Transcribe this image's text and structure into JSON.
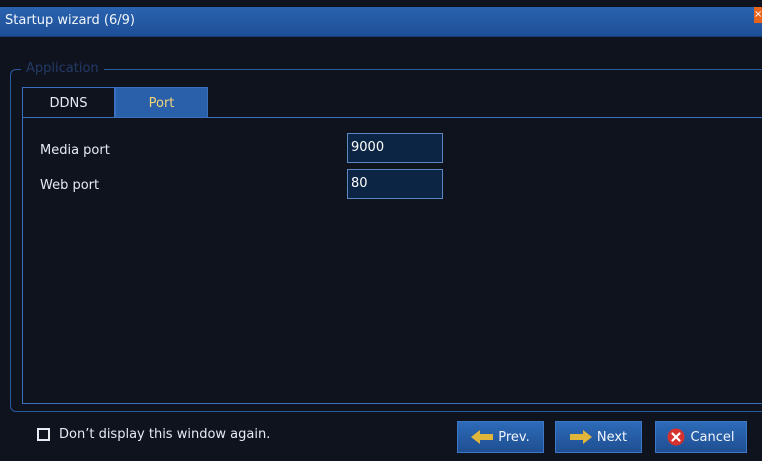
{
  "window": {
    "title": "Startup wizard (6/9)",
    "close_label": "×"
  },
  "group": {
    "legend": "Application"
  },
  "tabs": [
    {
      "label": "DDNS",
      "active": false
    },
    {
      "label": "Port",
      "active": true
    }
  ],
  "fields": {
    "media_port": {
      "label": "Media port",
      "value": "9000"
    },
    "web_port": {
      "label": "Web port",
      "value": "80"
    }
  },
  "footer": {
    "checkbox_label": "Don’t display this window again.",
    "checked": false,
    "prev_label": "Prev.",
    "next_label": "Next",
    "cancel_label": "Cancel"
  },
  "icons": {
    "prev": "arrow-left-icon",
    "next": "arrow-right-icon",
    "cancel": "cancel-x-icon",
    "close": "close-icon"
  },
  "colors": {
    "titlebar": "#2a63b0",
    "background": "#0e131d",
    "border": "#3a70bf",
    "active_tab": "#2a5faa",
    "active_tab_text": "#f2d37a",
    "close": "#e8631e",
    "arrow": "#e0b63a",
    "cancel_icon": "#d8322e"
  }
}
